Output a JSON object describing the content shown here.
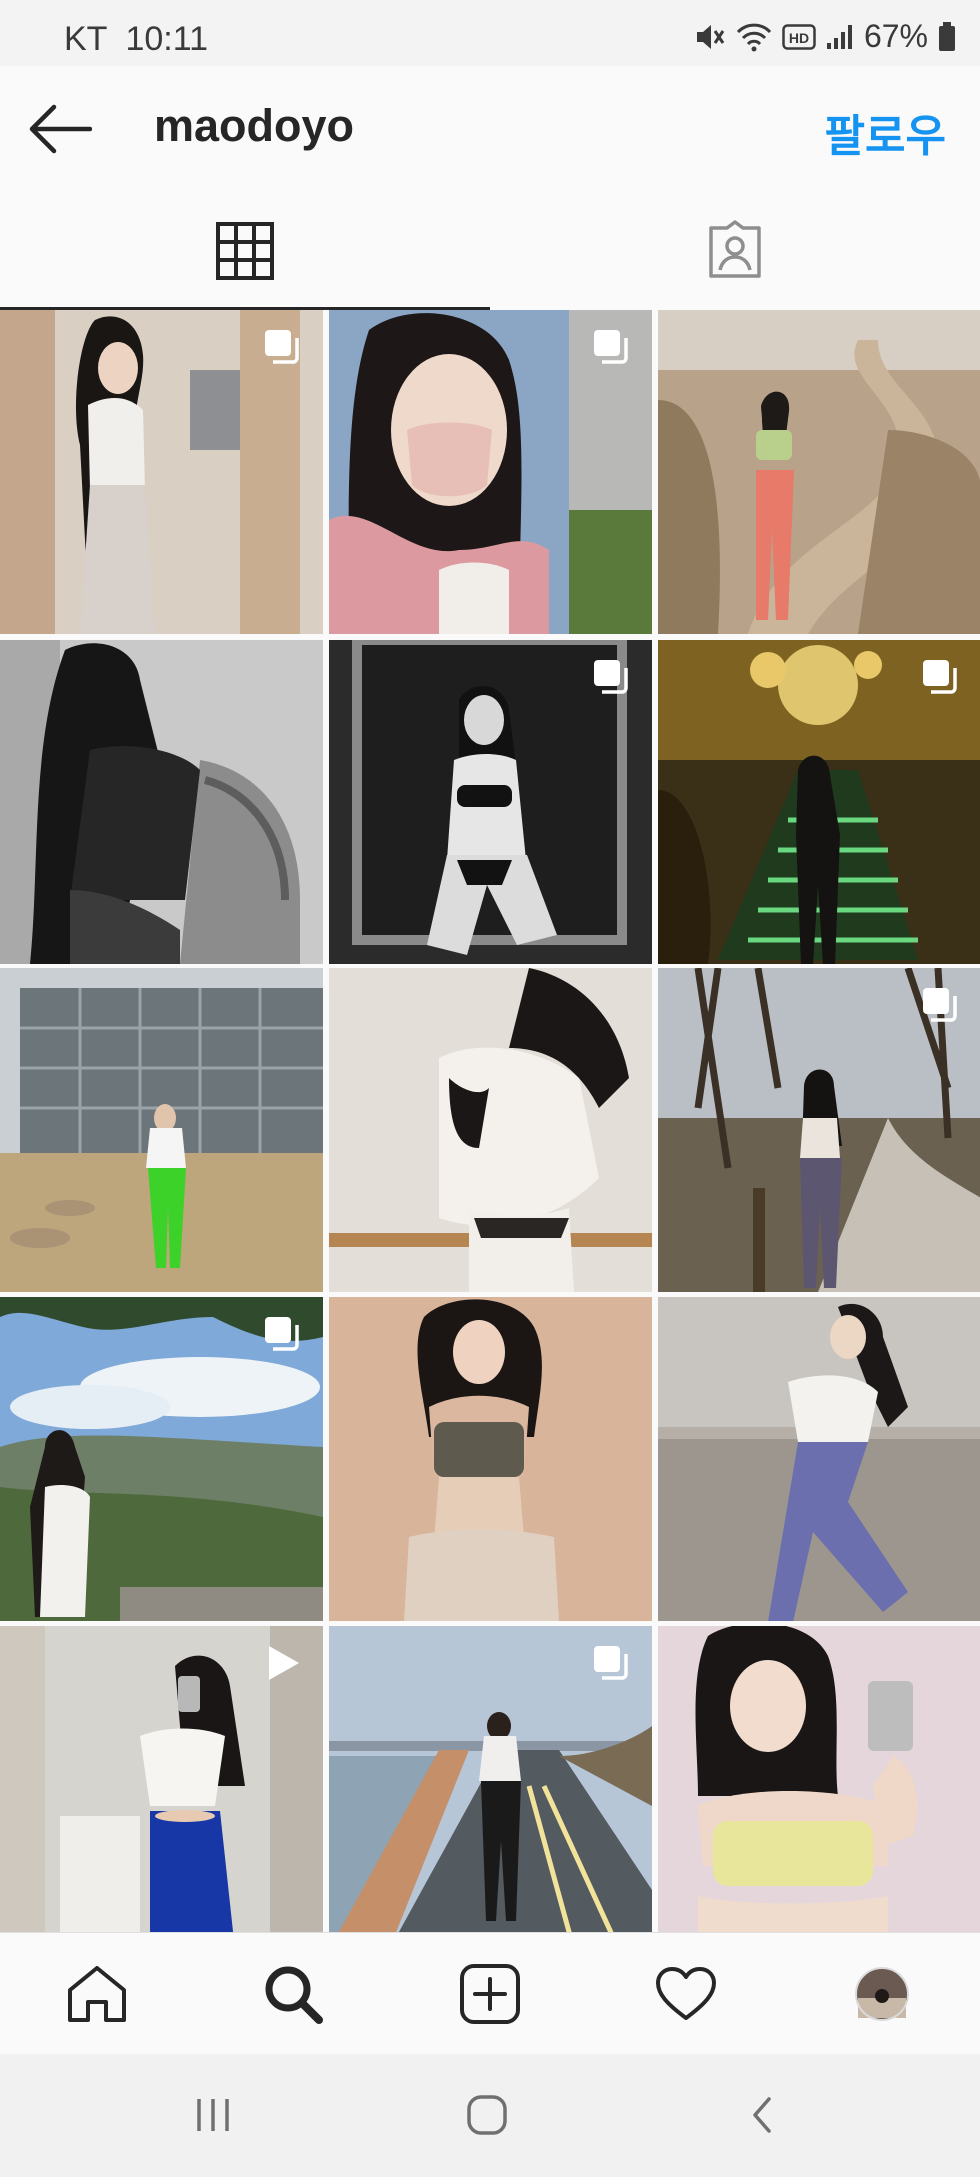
{
  "status_bar": {
    "carrier": "KT",
    "time": "10:11",
    "battery": "67%",
    "icons": [
      "mute-icon",
      "wifi-icon",
      "hd-icon",
      "signal-icon",
      "battery-icon"
    ]
  },
  "header": {
    "back_icon": "arrow-left-icon",
    "username": "maodoyo",
    "follow_label": "팔로우",
    "follow_color": "#1494f0"
  },
  "tabs": [
    {
      "name": "posts-grid",
      "icon": "grid-icon",
      "active": true
    },
    {
      "name": "tagged",
      "icon": "tagged-user-icon",
      "active": false
    }
  ],
  "posts": [
    {
      "badge": "multiple-photos-icon"
    },
    {
      "badge": "multiple-photos-icon"
    },
    {
      "badge": null
    },
    {
      "badge": null
    },
    {
      "badge": "multiple-photos-icon"
    },
    {
      "badge": "multiple-photos-icon"
    },
    {
      "badge": null
    },
    {
      "badge": null
    },
    {
      "badge": "multiple-photos-icon"
    },
    {
      "badge": "multiple-photos-icon"
    },
    {
      "badge": null
    },
    {
      "badge": null
    },
    {
      "badge": "video-icon"
    },
    {
      "badge": "multiple-photos-icon"
    },
    {
      "badge": null
    }
  ],
  "bottom_nav": [
    {
      "icon": "home-icon"
    },
    {
      "icon": "search-icon",
      "active": true
    },
    {
      "icon": "add-post-icon"
    },
    {
      "icon": "heart-icon"
    },
    {
      "icon": "profile-avatar"
    }
  ],
  "system_nav": [
    "recents-icon",
    "home-circle-icon",
    "back-chevron-icon"
  ]
}
